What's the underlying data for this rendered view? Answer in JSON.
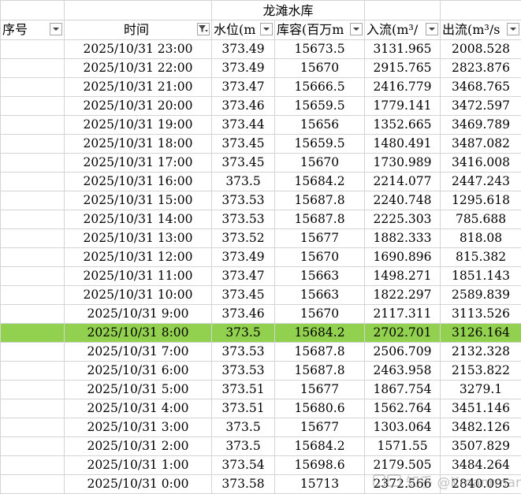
{
  "title": "龙滩水库",
  "headers": {
    "seq": "序号",
    "time": "时间",
    "level": "水位(m",
    "storage": "库容(百万m",
    "inflow": "入流(m³/",
    "outflow": "出流(m³/s"
  },
  "rows": [
    {
      "time": "2025/10/31 23:00",
      "level": "373.49",
      "storage": "15673.5",
      "inflow": "3131.965",
      "outflow": "2008.528"
    },
    {
      "time": "2025/10/31 22:00",
      "level": "373.49",
      "storage": "15670",
      "inflow": "2915.765",
      "outflow": "2823.876"
    },
    {
      "time": "2025/10/31 21:00",
      "level": "373.47",
      "storage": "15666.5",
      "inflow": "2416.779",
      "outflow": "3468.765"
    },
    {
      "time": "2025/10/31 20:00",
      "level": "373.46",
      "storage": "15659.5",
      "inflow": "1779.141",
      "outflow": "3472.597"
    },
    {
      "time": "2025/10/31 19:00",
      "level": "373.44",
      "storage": "15656",
      "inflow": "1352.665",
      "outflow": "3469.789"
    },
    {
      "time": "2025/10/31 18:00",
      "level": "373.45",
      "storage": "15659.5",
      "inflow": "1480.491",
      "outflow": "3487.082"
    },
    {
      "time": "2025/10/31 17:00",
      "level": "373.45",
      "storage": "15670",
      "inflow": "1730.989",
      "outflow": "3416.008"
    },
    {
      "time": "2025/10/31 16:00",
      "level": "373.5",
      "storage": "15684.2",
      "inflow": "2214.077",
      "outflow": "2447.243"
    },
    {
      "time": "2025/10/31 15:00",
      "level": "373.53",
      "storage": "15687.8",
      "inflow": "2240.748",
      "outflow": "1295.618"
    },
    {
      "time": "2025/10/31 14:00",
      "level": "373.53",
      "storage": "15687.8",
      "inflow": "2225.303",
      "outflow": "785.688"
    },
    {
      "time": "2025/10/31 13:00",
      "level": "373.52",
      "storage": "15677",
      "inflow": "1882.333",
      "outflow": "818.08"
    },
    {
      "time": "2025/10/31 12:00",
      "level": "373.49",
      "storage": "15670",
      "inflow": "1690.896",
      "outflow": "815.382"
    },
    {
      "time": "2025/10/31 11:00",
      "level": "373.47",
      "storage": "15663",
      "inflow": "1498.271",
      "outflow": "1851.143"
    },
    {
      "time": "2025/10/31 10:00",
      "level": "373.45",
      "storage": "15663",
      "inflow": "1822.297",
      "outflow": "2589.839"
    },
    {
      "time": "2025/10/31 9:00",
      "level": "373.46",
      "storage": "15670",
      "inflow": "2117.311",
      "outflow": "3113.526"
    },
    {
      "time": "2025/10/31 8:00",
      "level": "373.5",
      "storage": "15684.2",
      "inflow": "2702.701",
      "outflow": "3126.164",
      "highlight": true
    },
    {
      "time": "2025/10/31 7:00",
      "level": "373.53",
      "storage": "15687.8",
      "inflow": "2506.709",
      "outflow": "2132.328"
    },
    {
      "time": "2025/10/31 6:00",
      "level": "373.53",
      "storage": "15687.8",
      "inflow": "2463.958",
      "outflow": "2153.822"
    },
    {
      "time": "2025/10/31 5:00",
      "level": "373.51",
      "storage": "15677",
      "inflow": "1867.754",
      "outflow": "3279.1"
    },
    {
      "time": "2025/10/31 4:00",
      "level": "373.51",
      "storage": "15680.6",
      "inflow": "1562.764",
      "outflow": "3451.146"
    },
    {
      "time": "2025/10/31 3:00",
      "level": "373.5",
      "storage": "15677",
      "inflow": "1303.064",
      "outflow": "3482.126"
    },
    {
      "time": "2025/10/31 2:00",
      "level": "373.5",
      "storage": "15684.2",
      "inflow": "1571.55",
      "outflow": "3507.829"
    },
    {
      "time": "2025/10/31 1:00",
      "level": "373.54",
      "storage": "15698.6",
      "inflow": "2179.505",
      "outflow": "3484.264"
    },
    {
      "time": "2025/10/31 0:00",
      "level": "373.58",
      "storage": "15713",
      "inflow": "2372.566",
      "outflow": "2840.095"
    }
  ],
  "icons": {
    "filter": "dropdown-arrow-icon",
    "filter_active": "filter-funnel-icon"
  },
  "colors": {
    "highlight": "#92d050",
    "grid": "#d4d4d4"
  },
  "watermark": "知乎 @Kmanrmar"
}
